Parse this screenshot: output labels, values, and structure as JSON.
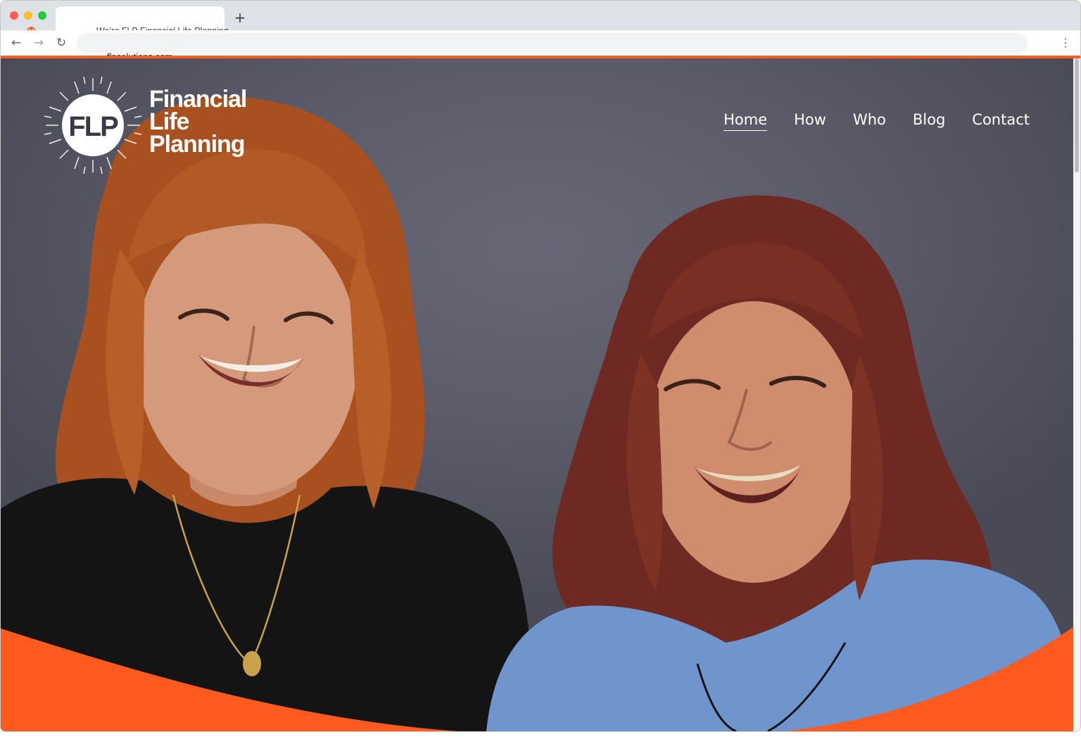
{
  "browser": {
    "tab_title": "We’re FLP Financial Life Planning",
    "new_tab_glyph": "+",
    "url": "flpsolutions.com",
    "back_glyph": "←",
    "forward_glyph": "→",
    "reload_glyph": "↻",
    "menu_glyph": "⋮",
    "favicon_text": "FLP"
  },
  "site": {
    "logo": {
      "monogram": "FLP",
      "line1": "Financial",
      "line2": "Life",
      "line3": "Planning"
    },
    "nav": [
      {
        "label": "Home",
        "active": true
      },
      {
        "label": "How",
        "active": false
      },
      {
        "label": "Who",
        "active": false
      },
      {
        "label": "Blog",
        "active": false
      },
      {
        "label": "Contact",
        "active": false
      }
    ]
  },
  "colors": {
    "brand_orange": "#ff5a1f",
    "hero_background": "#5e5e6b",
    "nav_text": "#ffffff"
  },
  "icons": {
    "back": "arrow-left-icon",
    "forward": "arrow-right-icon",
    "reload": "reload-icon",
    "menu": "more-vert-icon",
    "new_tab": "plus-icon"
  }
}
